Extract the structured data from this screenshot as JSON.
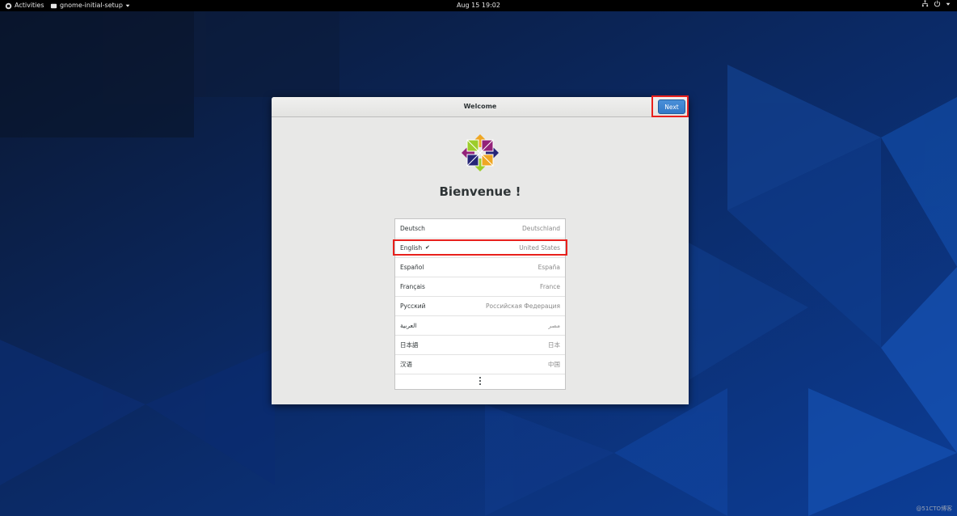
{
  "topbar": {
    "activities_label": "Activities",
    "app_menu_label": "gnome-initial-setup",
    "clock": "Aug 15  19:02",
    "status_icons": [
      "network-icon",
      "power-icon",
      "chevron-down-icon"
    ]
  },
  "window": {
    "title": "Welcome",
    "next_label": "Next",
    "heading": "Bienvenue !",
    "logo": "centos-logo",
    "languages": [
      {
        "name": "Deutsch",
        "region": "Deutschland",
        "selected": false
      },
      {
        "name": "English",
        "region": "United States",
        "selected": true,
        "check": "✔"
      },
      {
        "name": "Español",
        "region": "España",
        "selected": false
      },
      {
        "name": "Français",
        "region": "France",
        "selected": false
      },
      {
        "name": "Русский",
        "region": "Российская Федерация",
        "selected": false
      },
      {
        "name": "العربية",
        "region": "مصر",
        "selected": false
      },
      {
        "name": "日本語",
        "region": "日本",
        "selected": false
      },
      {
        "name": "汉语",
        "region": "中国",
        "selected": false
      }
    ],
    "more_icon": "view-more-icon"
  },
  "annotations": {
    "highlight_color": "#e8201c"
  },
  "watermark": "@51CTO博客",
  "colors": {
    "accent": "#3a80cc",
    "background": "#0a1f4a"
  }
}
